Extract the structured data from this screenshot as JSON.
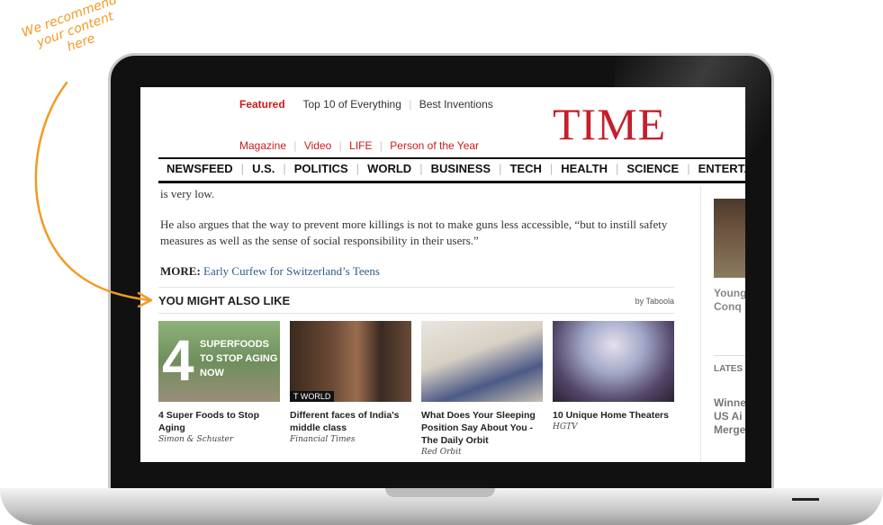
{
  "annotation": {
    "line1": "We recommend",
    "line2": "your content",
    "line3": "here",
    "color": "#f29a24"
  },
  "site": {
    "logo": "TIME",
    "top_links_1": {
      "featured": "Featured",
      "top10": "Top 10 of Everything",
      "inventions": "Best Inventions"
    },
    "top_links_2": {
      "magazine": "Magazine",
      "video": "Video",
      "life": "LIFE",
      "poty": "Person of the Year"
    },
    "main_nav": [
      "NEWSFEED",
      "U.S.",
      "POLITICS",
      "WORLD",
      "BUSINESS",
      "TECH",
      "HEALTH",
      "SCIENCE",
      "ENTERTA"
    ],
    "accent": "#c41f2b"
  },
  "article": {
    "p1": "is very low.",
    "p2": "He also argues that the way to prevent more killings is not to make guns less accessible, “but to instill safety measures as well as the sense of social responsibility in their users.”",
    "more_label": "MORE:",
    "more_link": "Early Curfew for Switzerland’s Teens"
  },
  "recommendations": {
    "title": "YOU MIGHT ALSO LIKE",
    "by": "by Taboola",
    "cards": [
      {
        "title": "4 Super Foods to Stop Aging",
        "source": "Simon & Schuster",
        "thumb_big": "4",
        "thumb_text": "SUPERFOODS TO STOP AGING NOW"
      },
      {
        "title": "Different faces of India's middle class",
        "source": "Financial Times",
        "thumb_text": "T WORLD"
      },
      {
        "title": "What Does Your Sleeping Position Say About You - The Daily Orbit",
        "source": "Red Orbit"
      },
      {
        "title": "10 Unique Home Theaters",
        "source": "HGTV"
      }
    ]
  },
  "sidebar": {
    "t1_line1": "Young",
    "t1_line2": "Conq",
    "label": "LATES",
    "t2_line1": "Winne",
    "t2_line2": "US Ai",
    "t2_line3": "Merge"
  }
}
